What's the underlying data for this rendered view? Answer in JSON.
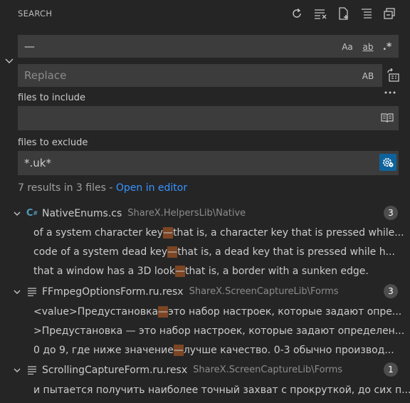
{
  "header": {
    "title": "SEARCH",
    "actions": [
      "refresh-icon",
      "clear-results-icon",
      "new-search-editor-icon",
      "collapse-all-icon",
      "expand-all-icon"
    ]
  },
  "search": {
    "value": "—",
    "options": {
      "match_case": "Aa",
      "whole_word": "ab",
      "regex": ".*"
    }
  },
  "replace": {
    "placeholder": "Replace",
    "preserve_case": "AB"
  },
  "include": {
    "label": "files to include",
    "value": ""
  },
  "exclude": {
    "label": "files to exclude",
    "value": "*.uk*"
  },
  "summary": {
    "text": "7 results in 3 files - ",
    "link": "Open in editor"
  },
  "results": [
    {
      "file": "NativeEnums.cs",
      "path": "ShareX.HelpersLib\\Native",
      "count": "3",
      "icon": "csharp-icon",
      "matches": [
        {
          "before": "of a system character key ",
          "match": "—",
          "after": " that is, a character key that is pressed while..."
        },
        {
          "before": "code of a system dead key ",
          "match": "—",
          "after": " that is, a dead key that is pressed while h..."
        },
        {
          "before": "that a window has a 3D look ",
          "match": "—",
          "after": " that is, a border with a sunken edge."
        }
      ]
    },
    {
      "file": "FFmpegOptionsForm.ru.resx",
      "path": "ShareX.ScreenCaptureLib\\Forms",
      "count": "3",
      "icon": "lines-icon",
      "matches": [
        {
          "before": "<value>Предустановка ",
          "match": "—",
          "after": " это набор настроек, которые задают опре..."
        },
        {
          "before": ">Предустановка — это набор настроек, которые задают определен...",
          "match": "",
          "after": ""
        },
        {
          "before": "0 до 9, где ниже значение ",
          "match": "—",
          "after": " лучше качество. 0-3 обычно производ..."
        }
      ]
    },
    {
      "file": "ScrollingCaptureForm.ru.resx",
      "path": "ShareX.ScreenCaptureLib\\Forms",
      "count": "1",
      "icon": "lines-icon",
      "matches": [
        {
          "before": "и пытается получить наиболее точный захват с прокруткой, до сих п...",
          "match": "",
          "after": ""
        }
      ]
    }
  ],
  "colors": {
    "background": "#252526",
    "input_background": "#3c3c3c",
    "link": "#3794ff",
    "match_highlight": "#7c4523",
    "badge": "#4d4d4d",
    "csharp_icon": "#519aba"
  }
}
